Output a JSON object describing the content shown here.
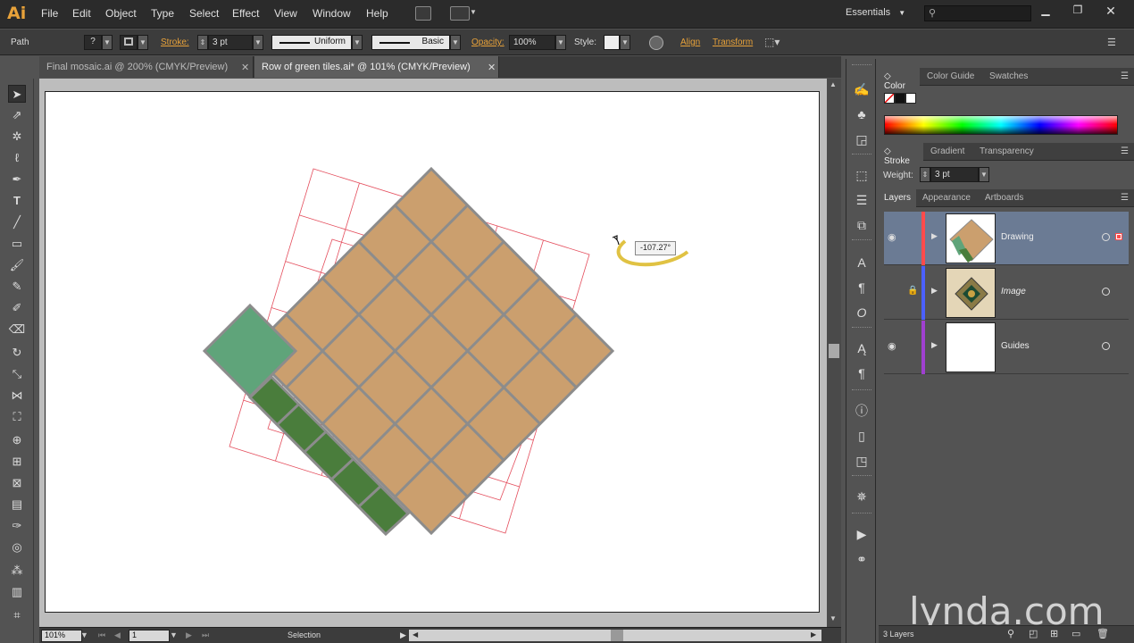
{
  "app": {
    "logo": "Ai"
  },
  "menu": [
    "File",
    "Edit",
    "Object",
    "Type",
    "Select",
    "Effect",
    "View",
    "Window",
    "Help"
  ],
  "workspace": "Essentials",
  "control_bar": {
    "selection_type": "Path",
    "stroke_label": "Stroke:",
    "stroke_weight": "3 pt",
    "profile": "Uniform",
    "brush": "Basic",
    "opacity_label": "Opacity:",
    "opacity": "100%",
    "style_label": "Style:",
    "align": "Align",
    "transform": "Transform"
  },
  "tabs": [
    {
      "label": "Final mosaic.ai @ 200% (CMYK/Preview)",
      "active": false
    },
    {
      "label": "Row of green tiles.ai* @ 101% (CMYK/Preview)",
      "active": true
    }
  ],
  "canvas": {
    "rotation_angle": "-107.27°",
    "tile_fill": "#cb9f6e",
    "tile_stroke": "#8c8c8c",
    "green_light": "#5fa47a",
    "green_dark": "#4a7d3c",
    "guide_color": "#e44d5c"
  },
  "status_bar": {
    "zoom": "101%",
    "artboard": "1",
    "tool": "Selection"
  },
  "color_panel": {
    "tabs": [
      "Color",
      "Color Guide",
      "Swatches"
    ]
  },
  "stroke_panel": {
    "tabs": [
      "Stroke",
      "Gradient",
      "Transparency"
    ],
    "weight_label": "Weight:",
    "weight": "3 pt"
  },
  "layers_panel": {
    "tabs": [
      "Layers",
      "Appearance",
      "Artboards"
    ],
    "layers": [
      {
        "name": "Drawing",
        "color": "#ff4b4b",
        "visible": true,
        "locked": false,
        "selected": true
      },
      {
        "name": "Image",
        "color": "#4b60ff",
        "visible": false,
        "locked": true,
        "selected": false
      },
      {
        "name": "Guides",
        "color": "#a040d0",
        "visible": true,
        "locked": false,
        "selected": false
      }
    ],
    "count_label": "3 Layers"
  },
  "watermark": "lynda.com"
}
